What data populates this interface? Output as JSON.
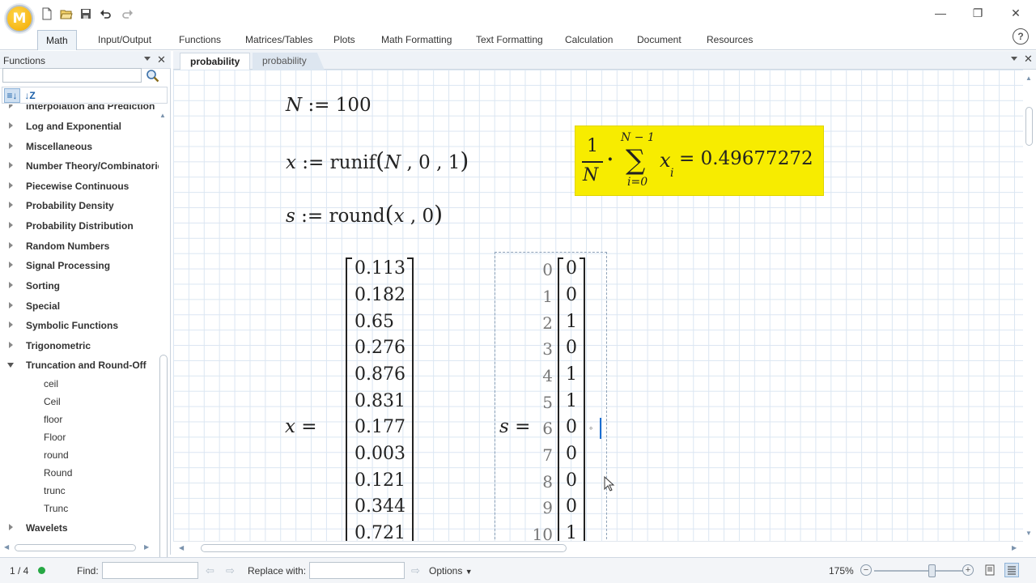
{
  "app": {
    "logo_letter": "M",
    "accent": "#f2a900"
  },
  "window_controls": {
    "minimize": "—",
    "restore": "❐",
    "close": "✕"
  },
  "ribbon": {
    "tabs": [
      "Math",
      "Input/Output",
      "Functions",
      "Matrices/Tables",
      "Plots",
      "Math Formatting",
      "Text Formatting",
      "Calculation",
      "Document",
      "Resources"
    ],
    "active_tab": "Math",
    "help_label": "?"
  },
  "functions_panel": {
    "title": "Functions",
    "search_placeholder": "",
    "categories": [
      "Interpolation and Prediction",
      "Log and Exponential",
      "Miscellaneous",
      "Number Theory/Combinatorics",
      "Piecewise Continuous",
      "Probability Density",
      "Probability Distribution",
      "Random Numbers",
      "Signal Processing",
      "Sorting",
      "Special",
      "Symbolic Functions",
      "Trigonometric",
      "Truncation and Round-Off"
    ],
    "expanded_children": [
      "ceil",
      "Ceil",
      "floor",
      "Floor",
      "round",
      "Round",
      "trunc",
      "Trunc"
    ],
    "last_category": "Wavelets"
  },
  "document_tabs": [
    {
      "label": "probability",
      "active": true
    },
    {
      "label": "probability",
      "active": false
    }
  ],
  "worksheet": {
    "def_N": {
      "var": "N",
      "op": ":=",
      "value": "100"
    },
    "def_x": {
      "var": "x",
      "op": ":=",
      "func": "runif",
      "open": "(",
      "args": [
        "N",
        "0",
        "1"
      ],
      "close": ")"
    },
    "def_s": {
      "var": "s",
      "op": ":=",
      "func": "round",
      "open": "(",
      "args": [
        "x",
        "0"
      ],
      "close": ")"
    },
    "mean_box": {
      "numerator": "1",
      "denominator": "N",
      "dot": "·",
      "sum_upper": "N − 1",
      "sum_lower": "i=0",
      "sigma": "∑",
      "term": "x",
      "subscript": "i",
      "result": "= 0.49677272",
      "color": "#f7ec00"
    },
    "x_eval": {
      "label": "x =",
      "values": [
        "0.113",
        "0.182",
        "0.65",
        "0.276",
        "0.876",
        "0.831",
        "0.177",
        "0.003",
        "0.121",
        "0.344",
        "0.721"
      ]
    },
    "s_eval": {
      "label": "s =",
      "indices": [
        "0",
        "1",
        "2",
        "3",
        "4",
        "5",
        "6",
        "7",
        "8",
        "9",
        "10"
      ],
      "values": [
        "0",
        "0",
        "1",
        "0",
        "1",
        "1",
        "0",
        "0",
        "0",
        "0",
        "1"
      ]
    }
  },
  "status_bar": {
    "page": "1 / 4",
    "find_label": "Find:",
    "find_value": "",
    "replace_label": "Replace with:",
    "replace_value": "",
    "options_label": "Options",
    "zoom": "175%"
  }
}
